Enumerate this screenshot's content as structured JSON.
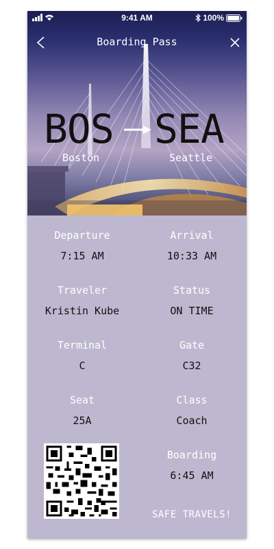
{
  "status_bar": {
    "time": "9:41 AM",
    "battery": "100%"
  },
  "nav": {
    "title": "Boarding Pass",
    "back_icon": "chevron-left-icon",
    "close_icon": "close-icon"
  },
  "route": {
    "from_code": "BOS",
    "to_code": "SEA",
    "from_city": "Boston",
    "to_city": "Seattle"
  },
  "details": {
    "departure": {
      "label": "Departure",
      "value": "7:15 AM"
    },
    "arrival": {
      "label": "Arrival",
      "value": "10:33 AM"
    },
    "traveler": {
      "label": "Traveler",
      "value": "Kristin Kube"
    },
    "status": {
      "label": "Status",
      "value": "ON TIME"
    },
    "terminal": {
      "label": "Terminal",
      "value": "C"
    },
    "gate": {
      "label": "Gate",
      "value": "C32"
    },
    "seat": {
      "label": "Seat",
      "value": "25A"
    },
    "class": {
      "label": "Class",
      "value": "Coach"
    },
    "boarding": {
      "label": "Boarding",
      "value": "6:45 AM"
    }
  },
  "footer": {
    "message": "SAFE TRAVELS!"
  },
  "colors": {
    "card_background": "#bdb8cf",
    "label_text": "#ffffff",
    "value_text": "#111111"
  }
}
